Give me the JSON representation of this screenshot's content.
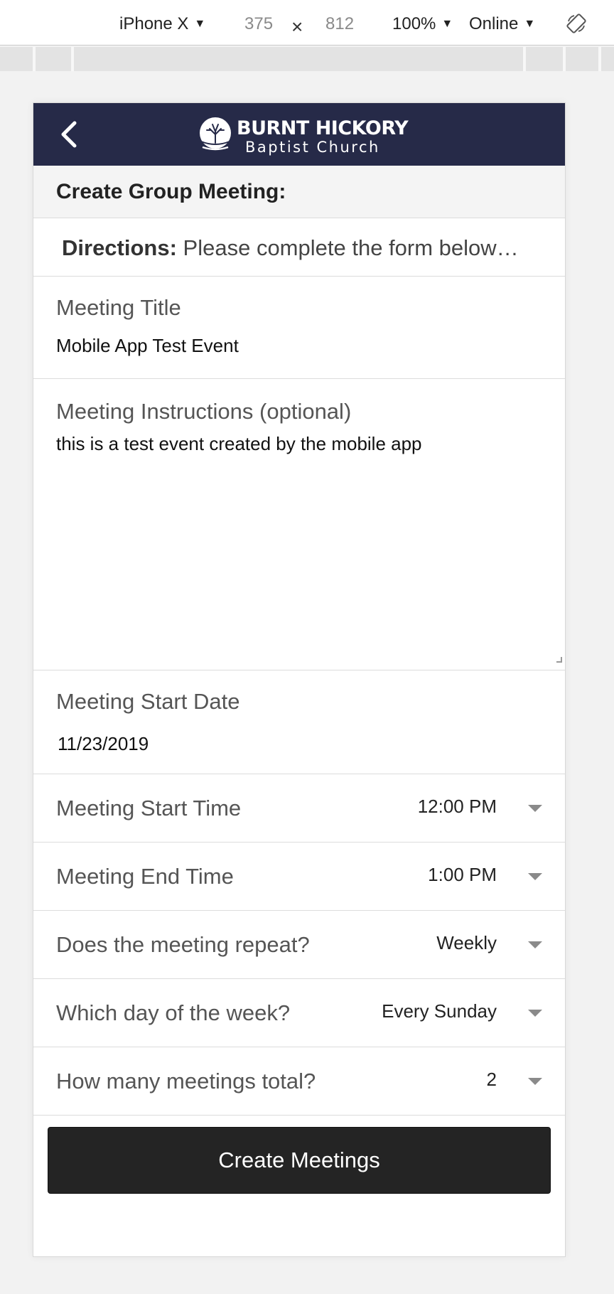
{
  "devtools": {
    "device": "iPhone X",
    "width": "375",
    "height": "812",
    "zoom": "100%",
    "network": "Online",
    "times": "×"
  },
  "header": {
    "logo_line1": "BURNT HICKORY",
    "logo_line2": "Baptist Church"
  },
  "page": {
    "title": "Create Group Meeting:",
    "directions_label": "Directions:",
    "directions_text": "Please complete the form below…"
  },
  "form": {
    "meeting_title": {
      "label": "Meeting Title",
      "value": "Mobile App Test Event"
    },
    "instructions": {
      "label": "Meeting Instructions (optional)",
      "value": "this is a test event created by the mobile app"
    },
    "start_date": {
      "label": "Meeting Start Date",
      "value": "11/23/2019"
    },
    "start_time": {
      "label": "Meeting Start Time",
      "value": "12:00 PM"
    },
    "end_time": {
      "label": "Meeting End Time",
      "value": "1:00 PM"
    },
    "repeat": {
      "label": "Does the meeting repeat?",
      "value": "Weekly"
    },
    "day_of_week": {
      "label": "Which day of the week?",
      "value": "Every Sunday"
    },
    "total": {
      "label": "How many meetings total?",
      "value": "2"
    },
    "submit_label": "Create Meetings"
  },
  "colors": {
    "header_bg": "#262a48",
    "button_bg": "#242424"
  }
}
